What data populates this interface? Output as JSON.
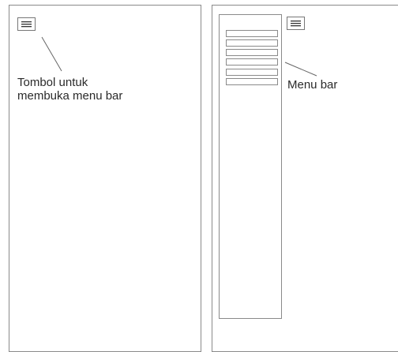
{
  "left_panel": {
    "menu_button": {
      "icon": "hamburger-menu-icon"
    },
    "annotation": {
      "line1": "Tombol untuk",
      "line2": "membuka menu bar"
    }
  },
  "right_panel": {
    "menu_button": {
      "icon": "hamburger-menu-icon"
    },
    "annotation": "Menu bar",
    "sidebar": {
      "items": [
        "",
        "",
        "",
        "",
        "",
        ""
      ]
    }
  },
  "colors": {
    "border": "#8a8a8a",
    "text": "#2a2a2a",
    "background": "#ffffff"
  }
}
